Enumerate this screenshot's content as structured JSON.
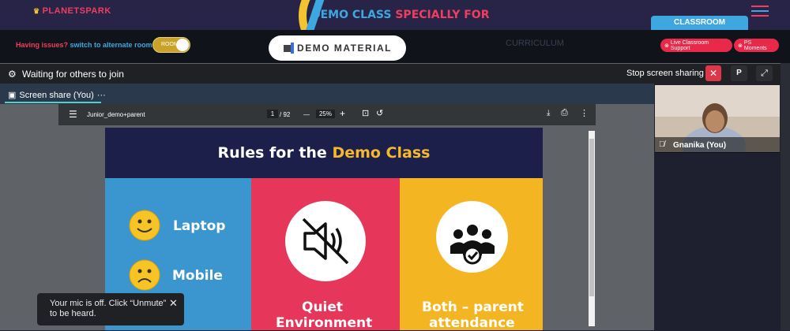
{
  "brand": {
    "logo_text": "PLANETSPARK"
  },
  "header": {
    "title_part1": "DEMO CLASS",
    "title_part2": "SPECIALLY FOR",
    "title_color1": "#3fa7e0",
    "title_color2": "#ef3e5f"
  },
  "menu_icon": "hamburger-icon",
  "room_bar": {
    "issues_text": "Having issues?",
    "alternate_text": "switch to alternate room",
    "toggle_label": "ROOM",
    "demo_material_label": "DEMO MATERIAL",
    "curriculum_label": "CURRICULUM",
    "classroom_tab": "CLASSROOM",
    "live_support_label": "Live Classroom Support",
    "ps_moments_label": "PS Moments"
  },
  "meeting": {
    "status_text": "Waiting for others to join",
    "stop_share_label": "Stop screen sharing",
    "close_label": "✕",
    "p_button_label": "P",
    "tab_label": "Screen share (You)",
    "tab_more": "···"
  },
  "pdf": {
    "filename": "Junior_demo+parent",
    "current_page": "1",
    "total_pages": "/ 92",
    "zoom_minus": "—",
    "zoom": "25%",
    "zoom_plus": "+"
  },
  "slide": {
    "heading_part1": "Rules for the",
    "heading_part2": "Demo Class",
    "col1_items": [
      "Laptop",
      "Mobile"
    ],
    "col2_label_line1": "Quiet",
    "col2_label_line2": "Environment",
    "col3_label_line1": "Both – parent",
    "col3_label_line2": "attendance",
    "colors": {
      "header": "#1b1f4a",
      "blue": "#3b96d0",
      "pink": "#e6365a",
      "yellow": "#f3b521"
    }
  },
  "participant": {
    "name": "Gnanika (You)"
  },
  "toast": {
    "text": "Your mic is off. Click “Unmute” to be heard.",
    "close": "✕"
  }
}
